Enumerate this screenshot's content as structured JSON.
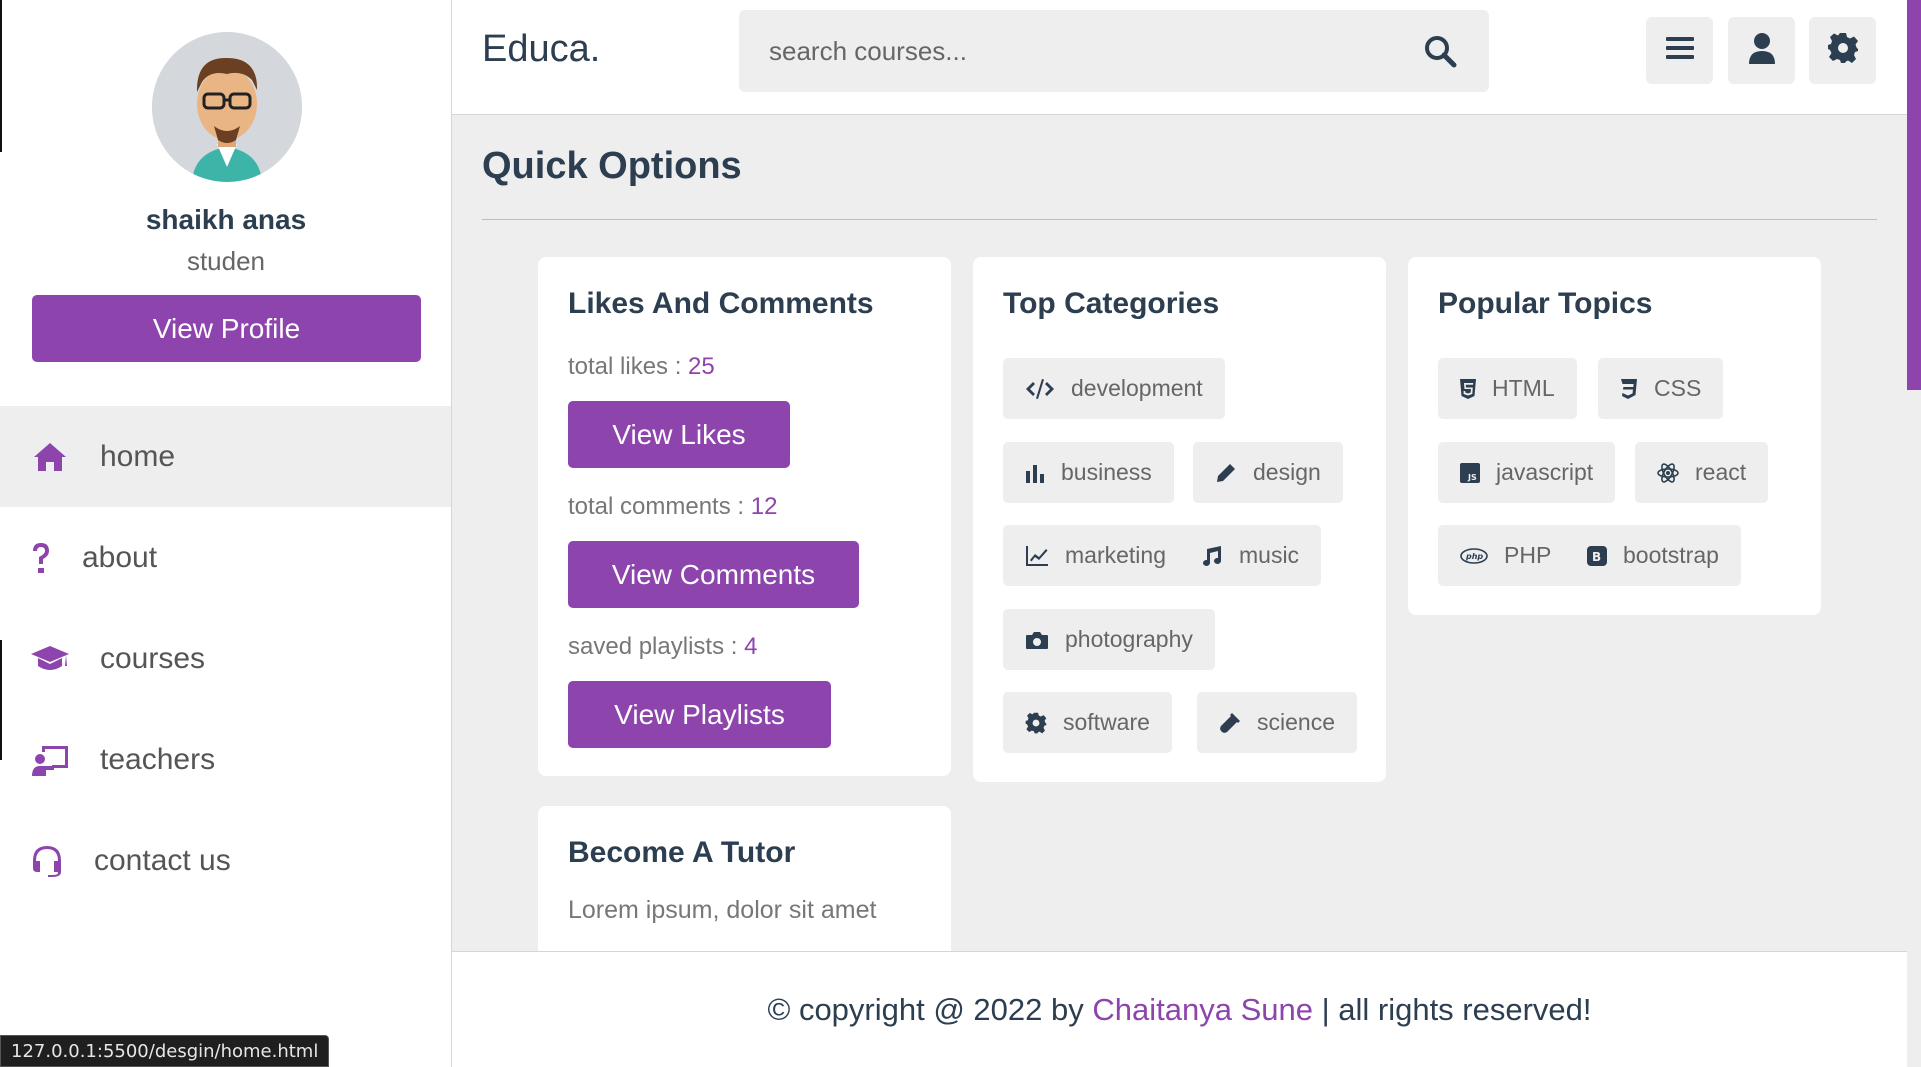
{
  "app": {
    "logo": "Educa."
  },
  "search": {
    "placeholder": "search courses..."
  },
  "header_buttons": [
    {
      "icon": "menu-icon"
    },
    {
      "icon": "user-icon"
    },
    {
      "icon": "gear-icon"
    }
  ],
  "profile": {
    "name": "shaikh anas",
    "role": "studen",
    "button": "View Profile"
  },
  "nav": [
    {
      "label": "home",
      "icon": "home-icon",
      "active": true
    },
    {
      "label": "about",
      "icon": "question-icon"
    },
    {
      "label": "courses",
      "icon": "graduation-cap-icon"
    },
    {
      "label": "teachers",
      "icon": "chalkboard-teacher-icon"
    },
    {
      "label": "contact us",
      "icon": "headset-icon"
    }
  ],
  "main": {
    "title": "Quick Options"
  },
  "likes_card": {
    "title": "Likes And Comments",
    "likes_label": "total likes : ",
    "likes_value": "25",
    "likes_button": "View Likes",
    "comments_label": "total comments : ",
    "comments_value": "12",
    "comments_button": "View Comments",
    "playlists_label": "saved playlists : ",
    "playlists_value": "4",
    "playlists_button": "View Playlists"
  },
  "categories_card": {
    "title": "Top Categories",
    "items": [
      "development",
      "business",
      "design",
      "marketing",
      "music",
      "photography",
      "software",
      "science"
    ]
  },
  "topics_card": {
    "title": "Popular Topics",
    "items": [
      "HTML",
      "CSS",
      "javascript",
      "react",
      "PHP",
      "bootstrap"
    ]
  },
  "tutor_card": {
    "title": "Become A Tutor",
    "text": "Lorem ipsum, dolor sit amet"
  },
  "footer": {
    "prefix": "© copyright @ 2022 by ",
    "author": "Chaitanya Sune",
    "suffix": " | all rights reserved!"
  },
  "status_bar": {
    "url": "127.0.0.1:5500/desgin/home.html"
  },
  "colors": {
    "accent": "#8e44ad",
    "text": "#2c3e50",
    "background": "#eeeeee"
  }
}
